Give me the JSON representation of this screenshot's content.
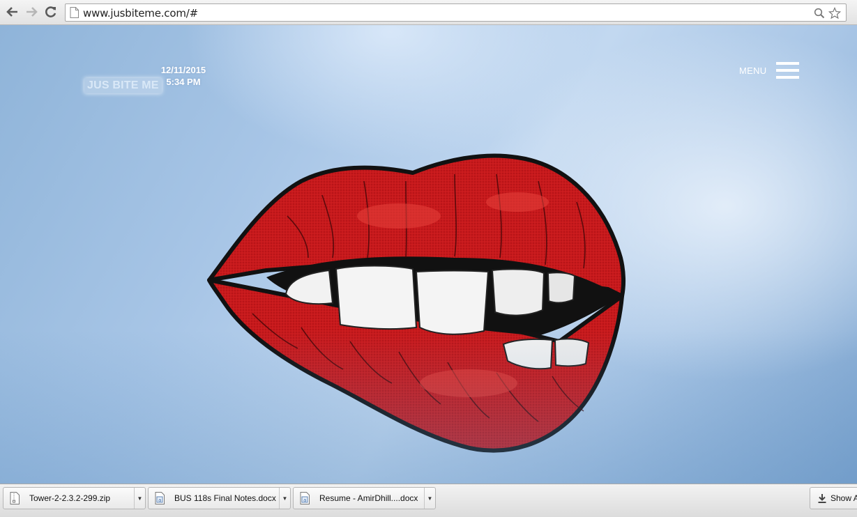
{
  "browser": {
    "url": "www.jusbiteme.com/#",
    "back_icon": "back-arrow-icon",
    "forward_icon": "forward-arrow-icon",
    "reload_icon": "reload-icon",
    "search_icon": "magnifier-icon",
    "bookmark_icon": "star-icon"
  },
  "site": {
    "logo": "JUS BITE ME",
    "date": "12/11/2015",
    "time": "5:34 PM",
    "menu_label": "MENU",
    "hero_image": "lips-biting-illustration",
    "colors": {
      "background": "#a9c6e6",
      "lips": "#c8191c"
    }
  },
  "downloads": {
    "items": [
      {
        "name": "Tower-2-2.3.2-299.zip",
        "icon": "zip-file-icon"
      },
      {
        "name": "BUS 118s Final Notes.docx",
        "icon": "docx-file-icon"
      },
      {
        "name": "Resume - AmirDhill....docx",
        "icon": "docx-file-icon"
      }
    ],
    "show_all_label": "Show A"
  }
}
